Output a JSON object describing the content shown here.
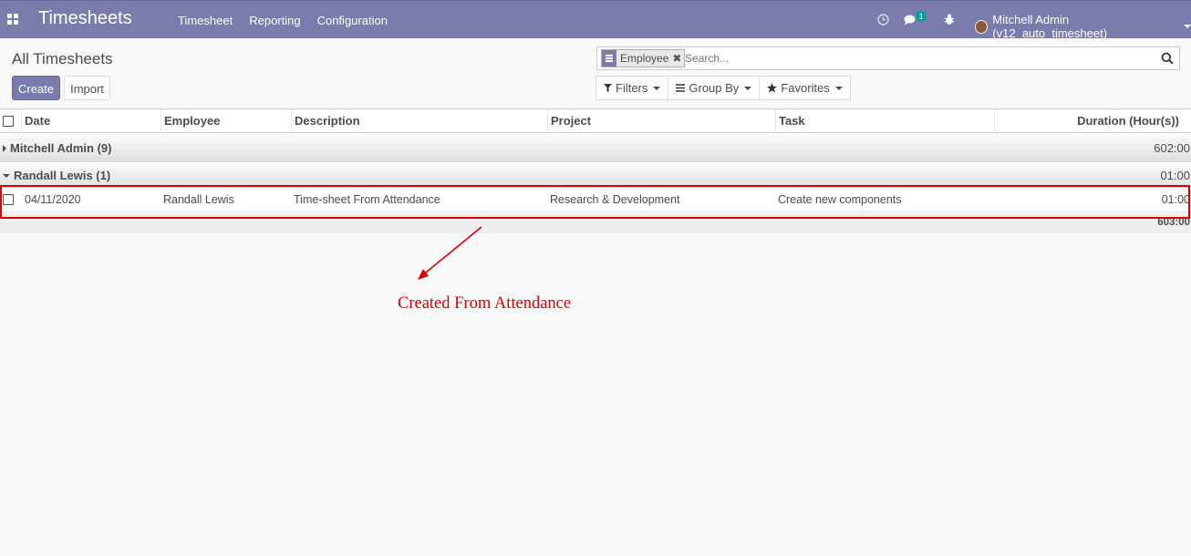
{
  "navbar": {
    "title": "Timesheets",
    "menu": [
      "Timesheet",
      "Reporting",
      "Configuration"
    ],
    "chat_badge": "1",
    "user": "Mitchell Admin (v12_auto_timesheet)"
  },
  "control": {
    "title": "All Timesheets",
    "create_label": "Create",
    "import_label": "Import",
    "facet_label": "Employee",
    "facet_close": "✖",
    "search_placeholder": "Search...",
    "filters_label": "Filters",
    "groupby_label": "Group By",
    "favorites_label": "Favorites"
  },
  "table": {
    "headers": [
      "Date",
      "Employee",
      "Description",
      "Project",
      "Task",
      "Duration (Hour(s))"
    ],
    "groups": [
      {
        "label": "Mitchell Admin (9)",
        "total": "602:00",
        "expanded": false
      },
      {
        "label": "Randall Lewis (1)",
        "total": "01:00",
        "expanded": true
      }
    ],
    "rows": [
      {
        "date": "04/11/2020",
        "employee": "Randall Lewis",
        "description": "Time-sheet From Attendance",
        "project": "Research & Development",
        "task": "Create new components",
        "duration": "01:00"
      }
    ],
    "grand_total": "603:00"
  },
  "annotation": {
    "text": "Created From Attendance",
    "color": "#e00000"
  },
  "colors": {
    "brand": "#7c7bad",
    "badge": "#00a09d"
  }
}
